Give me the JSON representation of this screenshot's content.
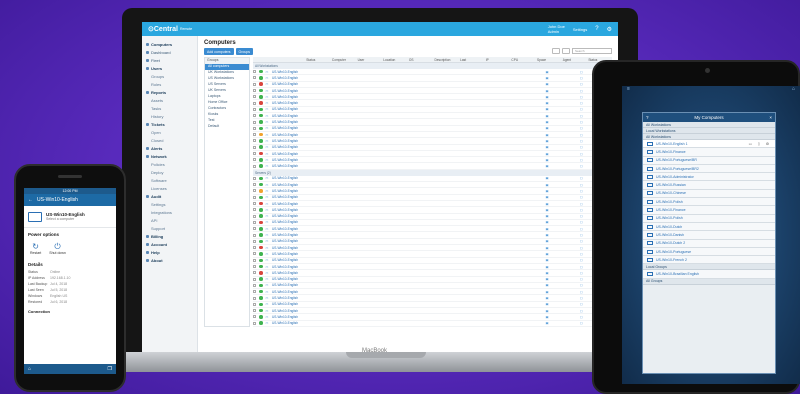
{
  "laptop": {
    "brand": "MacBook",
    "app": {
      "logo": "⊙Central",
      "logo_suffix": "Remote",
      "user_line1": "John Doe",
      "user_line2": "Admin",
      "settings_label": "Settings",
      "page_title": "Computers",
      "toolbar": {
        "btn1": "Add computers",
        "btn2": "Groups",
        "search_placeholder": "Search"
      },
      "sidebar": [
        {
          "label": "Computers",
          "type": "head"
        },
        {
          "label": "Dashboard",
          "type": "item"
        },
        {
          "label": "Fleet",
          "type": "item"
        },
        {
          "label": "Users",
          "type": "head"
        },
        {
          "label": "Groups",
          "type": "sub"
        },
        {
          "label": "Roles",
          "type": "sub"
        },
        {
          "label": "Reports",
          "type": "head"
        },
        {
          "label": "Assets",
          "type": "sub"
        },
        {
          "label": "Tasks",
          "type": "sub"
        },
        {
          "label": "History",
          "type": "sub"
        },
        {
          "label": "Tickets",
          "type": "head"
        },
        {
          "label": "Open",
          "type": "sub"
        },
        {
          "label": "Closed",
          "type": "sub"
        },
        {
          "label": "Alerts",
          "type": "head"
        },
        {
          "label": "Network",
          "type": "head"
        },
        {
          "label": "Policies",
          "type": "sub"
        },
        {
          "label": "Deploy",
          "type": "sub"
        },
        {
          "label": "Software",
          "type": "sub"
        },
        {
          "label": "Licenses",
          "type": "sub"
        },
        {
          "label": "Audit",
          "type": "head"
        },
        {
          "label": "Settings",
          "type": "sub"
        },
        {
          "label": "Integrations",
          "type": "sub"
        },
        {
          "label": "API",
          "type": "sub"
        },
        {
          "label": "Support",
          "type": "sub"
        },
        {
          "label": "Billing",
          "type": "head"
        },
        {
          "label": "Account",
          "type": "head"
        },
        {
          "label": "Help",
          "type": "head"
        },
        {
          "label": "About",
          "type": "head"
        }
      ],
      "groups_header": "Groups",
      "groups": [
        "All computers",
        "UK Workstations",
        "US Workstations",
        "US Servers",
        "UK Servers",
        "Laptops",
        "Home Office",
        "Contractors",
        "Kiosks",
        "Test",
        "Default"
      ],
      "columns": [
        "",
        "",
        "Status",
        "Computer",
        "User",
        "Location",
        "OS",
        "Description",
        "Last",
        "IP",
        "CPU",
        "Space",
        "Agent",
        "Status"
      ],
      "group_rows": [
        "All Workstations",
        "Servers (2)"
      ],
      "rows": [
        {
          "st": "green",
          "name": "US-Win10-English"
        },
        {
          "st": "green",
          "name": "US-Win10-English"
        },
        {
          "st": "red",
          "name": "US-Win10-English"
        },
        {
          "st": "green",
          "name": "US-Win10-English"
        },
        {
          "st": "green",
          "name": "US-Win10-English"
        },
        {
          "st": "red",
          "name": "US-Win10-English"
        },
        {
          "st": "green",
          "name": "US-Win10-English"
        },
        {
          "st": "green",
          "name": "US-Win10-English"
        },
        {
          "st": "green",
          "name": "US-Win10-English"
        },
        {
          "st": "green",
          "name": "US-Win10-English"
        },
        {
          "st": "orange",
          "name": "US-Win10-English"
        },
        {
          "st": "green",
          "name": "US-Win10-English"
        },
        {
          "st": "green",
          "name": "US-Win10-English"
        },
        {
          "st": "red",
          "name": "US-Win10-English"
        },
        {
          "st": "green",
          "name": "US-Win10-English"
        },
        {
          "st": "green",
          "name": "US-Win10-English"
        }
      ],
      "rows2": [
        {
          "st": "green",
          "name": "US-Win10-English"
        },
        {
          "st": "green",
          "name": "US-Win10-English"
        },
        {
          "st": "orange",
          "name": "US-Win10-English"
        },
        {
          "st": "green",
          "name": "US-Win10-English"
        },
        {
          "st": "red",
          "name": "US-Win10-English"
        },
        {
          "st": "green",
          "name": "US-Win10-English"
        },
        {
          "st": "green",
          "name": "US-Win10-English"
        },
        {
          "st": "red",
          "name": "US-Win10-English"
        },
        {
          "st": "green",
          "name": "US-Win10-English"
        },
        {
          "st": "green",
          "name": "US-Win10-English"
        },
        {
          "st": "green",
          "name": "US-Win10-English"
        },
        {
          "st": "red",
          "name": "US-Win10-English"
        },
        {
          "st": "green",
          "name": "US-Win10-English"
        },
        {
          "st": "green",
          "name": "US-Win10-English"
        },
        {
          "st": "green",
          "name": "US-Win10-English"
        },
        {
          "st": "red",
          "name": "US-Win10-English"
        },
        {
          "st": "green",
          "name": "US-Win10-English"
        },
        {
          "st": "green",
          "name": "US-Win10-English"
        },
        {
          "st": "green",
          "name": "US-Win10-English"
        },
        {
          "st": "green",
          "name": "US-Win10-English"
        },
        {
          "st": "green",
          "name": "US-Win10-English"
        },
        {
          "st": "green",
          "name": "US-Win10-English"
        },
        {
          "st": "green",
          "name": "US-Win10-English"
        },
        {
          "st": "green",
          "name": "US-Win10-English"
        }
      ]
    }
  },
  "phone": {
    "time": "12:00 PM",
    "title": "US-Win10-English",
    "device_name": "US-Win10-English",
    "device_sub": "Select a computer",
    "power_title": "Power options",
    "actions": [
      {
        "icon": "↻",
        "label": "Restart"
      },
      {
        "icon": "⏻",
        "label": "Shut down"
      }
    ],
    "details_title": "Details",
    "details": [
      {
        "k": "Status",
        "v": "Online"
      },
      {
        "k": "IP Address",
        "v": "192.168.1.10"
      },
      {
        "k": "Last Backup",
        "v": "Jul 4, 2018"
      },
      {
        "k": "Last Seen",
        "v": "Jul 5, 2018"
      },
      {
        "k": "Windows",
        "v": "English US"
      },
      {
        "k": "Restored",
        "v": "Jul 6, 2018"
      }
    ],
    "bottom_label": "Connection"
  },
  "tablet": {
    "title": "My Computers",
    "groups": [
      "All Workstations",
      "Local Workstations",
      "All Workstations"
    ],
    "items": [
      "US-Win10-English 1",
      "US-Win10-Finance",
      "US-Win10-Portuguese/BR",
      "US-Win10-Portuguese/BR2",
      "US-Win10-Administrator",
      "US-Win10-Russian",
      "US-Win10-Chinese",
      "US-Win10-Polish",
      "US-Win10-Finance",
      "US-Win10-Polish",
      "US-Win10-Dutch",
      "US-Win10-Danish",
      "US-Win10-Dutch 2",
      "US-Win10-Portuguese",
      "US-Win10-French 2"
    ],
    "group_bottom": [
      "Local Groups",
      "US-Win10-Brazilian English"
    ],
    "group_bottom2": "All Groups"
  },
  "colors": {
    "accent": "#2aa7df",
    "green": "#3fb34f",
    "red": "#d9453d",
    "orange": "#f0a22e"
  }
}
